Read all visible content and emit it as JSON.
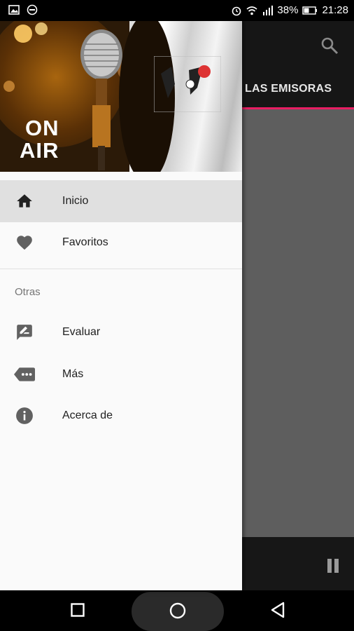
{
  "status_bar": {
    "battery": "38%",
    "time": "21:28"
  },
  "background_app": {
    "tab_label": "LAS EMISORAS"
  },
  "drawer": {
    "header": {
      "badge_text_line1": "ON",
      "badge_text_line2": "AIR"
    },
    "main_items": [
      {
        "label": "Inicio",
        "icon": "home-icon",
        "active": true
      },
      {
        "label": "Favoritos",
        "icon": "heart-icon",
        "active": false
      }
    ],
    "section_title": "Otras",
    "other_items": [
      {
        "label": "Evaluar",
        "icon": "rate-review-icon"
      },
      {
        "label": "Más",
        "icon": "more-tag-icon"
      },
      {
        "label": "Acerca de",
        "icon": "info-icon"
      }
    ]
  },
  "colors": {
    "accent": "#e91e63",
    "drawer_bg": "#fafafa",
    "active_item_bg": "#e0e0e0",
    "icon": "#616161"
  }
}
